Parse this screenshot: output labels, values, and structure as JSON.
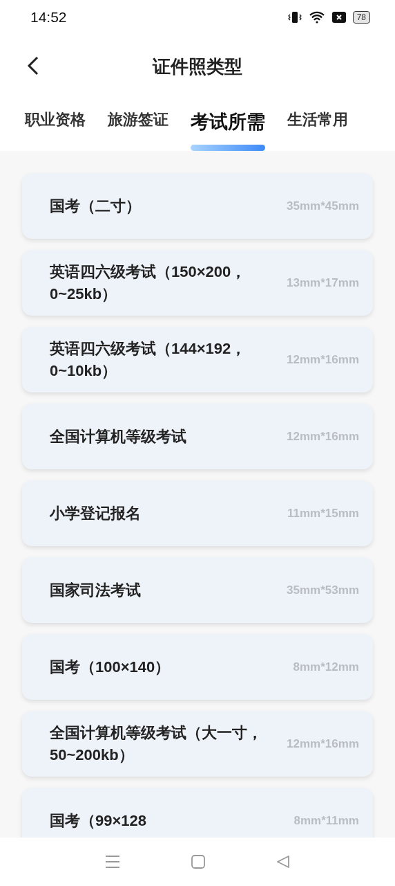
{
  "status_bar": {
    "time": "14:52",
    "battery": "78"
  },
  "header": {
    "title": "证件照类型"
  },
  "tabs": [
    {
      "label": "职业资格",
      "selected": false
    },
    {
      "label": "旅游签证",
      "selected": false
    },
    {
      "label": "考试所需",
      "selected": true
    },
    {
      "label": "生活常用",
      "selected": false
    }
  ],
  "items": [
    {
      "name": "国考（二寸）",
      "size": "35mm*45mm"
    },
    {
      "name": "英语四六级考试（150×200，0~25kb）",
      "size": "13mm*17mm"
    },
    {
      "name": "英语四六级考试（144×192，0~10kb）",
      "size": "12mm*16mm"
    },
    {
      "name": "全国计算机等级考试",
      "size": "12mm*16mm"
    },
    {
      "name": "小学登记报名",
      "size": "11mm*15mm"
    },
    {
      "name": "国家司法考试",
      "size": "35mm*53mm"
    },
    {
      "name": "国考（100×140）",
      "size": "8mm*12mm"
    },
    {
      "name": "全国计算机等级考试（大一寸，50~200kb）",
      "size": "12mm*16mm"
    },
    {
      "name": "国考（99×128",
      "size": "8mm*11mm"
    }
  ]
}
